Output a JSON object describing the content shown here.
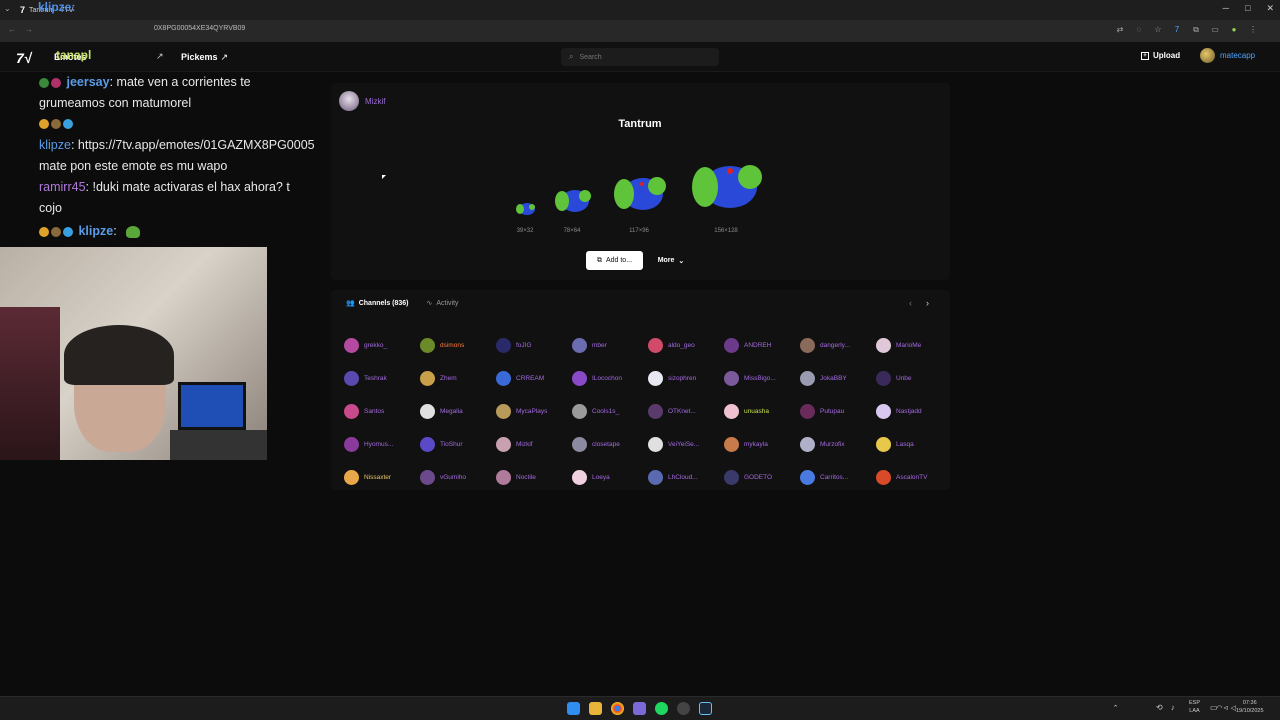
{
  "browser": {
    "tab_title": "Tantrum - 7TV",
    "url": "0X8PG00054XE34QYRVB09",
    "window_controls": [
      "─",
      "□",
      "✕"
    ]
  },
  "site": {
    "nav": {
      "emotes": "Emotes",
      "pickems": "Pickems"
    },
    "search_placeholder": "Search",
    "upload_label": "Upload",
    "username": "matecapp"
  },
  "chat": {
    "lines": [
      {
        "nick": "jeersay",
        "text": ": mate ven a corrientes te"
      },
      {
        "text": "grumeamos con matumorel"
      },
      {
        "nick": "klipze",
        "text": ": https://7tv.app/emotes/01GAZMX8PG0005"
      },
      {
        "text": "mate pon este emote es mu wapo"
      },
      {
        "nick": "ramirr45",
        "text": ": !duki mate activaras el hax ahora? t"
      },
      {
        "text": "cojo"
      },
      {
        "nick": "klipze",
        "text": ":"
      }
    ],
    "overlay_top": "klipze:",
    "overlay_name": "tanapl"
  },
  "emote": {
    "owner": "Mizkif",
    "title": "Tantrum",
    "sizes": [
      "39×32",
      "78×64",
      "117×96",
      "156×128"
    ],
    "add_label": "Add to...",
    "more_label": "More"
  },
  "channels": {
    "tab_active": "Channels (836)",
    "tab_other": "Activity",
    "list": [
      "grekko_",
      "dsimons",
      "foJIG",
      "mber",
      "aldo_geo",
      "ANDREH",
      "dangerly...",
      "MarioMe",
      "Teshrak",
      "Zhem",
      "CRREAM",
      "ILocochon",
      "sizophren",
      "MissBigo...",
      "JokaBBY",
      "Unbe",
      "Santos",
      "Megalia",
      "MycaPlays",
      "Cools1s_",
      "OTKnet...",
      "unuasha",
      "Putupau",
      "Nastjadd",
      "Hyomus...",
      "TioShur",
      "Mizkif",
      "closetape",
      "VeiYeiSe...",
      "mykayla",
      "Murzofix",
      "Lasqa",
      "Nissaxter",
      "vGumiho",
      "Noctile",
      "Loeya",
      "LhCloud...",
      "GODETO",
      "Carritos...",
      "AscalonTV"
    ],
    "special_colors": {
      "dsimons": "#ff7a3a",
      "unuasha": "#c9e34f",
      "Nissaxter": "#e9c46a",
      "Teshrak": "#a36ae0"
    }
  },
  "taskbar": {
    "lang_line1": "ESP",
    "lang_line2": "LAA",
    "time": "07:36",
    "date": "19/10/2025"
  }
}
